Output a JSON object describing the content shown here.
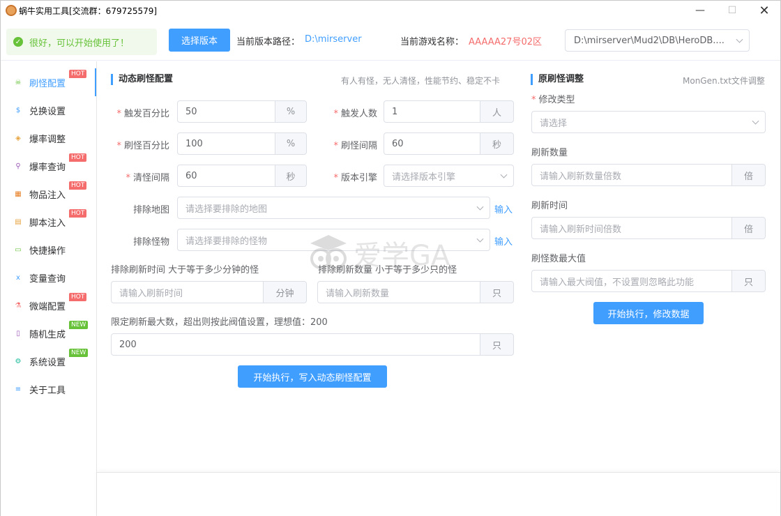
{
  "window": {
    "title": "蜗牛实用工具[交流群：679725579]",
    "controls": {
      "minimize": "—",
      "maximize": "☐",
      "close": "✕"
    }
  },
  "topbar": {
    "alert_text": "很好，可以开始使用了！",
    "select_version_label": "选择版本",
    "version_path_label": "当前版本路径：",
    "version_path_value": "D:\\mirserver",
    "game_name_label": "当前游戏名称：",
    "game_name_value": "AAAAA27号02区",
    "db_select_value": "D:\\mirserver\\Mud2\\DB\\HeroDB...."
  },
  "sidebar": {
    "items": [
      {
        "label": "刷怪配置",
        "icon": "monster-icon",
        "badge": "HOT",
        "active": true
      },
      {
        "label": "兑换设置",
        "icon": "exchange-icon",
        "badge": ""
      },
      {
        "label": "爆率调整",
        "icon": "cube-icon",
        "badge": ""
      },
      {
        "label": "爆率查询",
        "icon": "search-icon",
        "badge": "HOT"
      },
      {
        "label": "物品注入",
        "icon": "items-icon",
        "badge": "HOT"
      },
      {
        "label": "脚本注入",
        "icon": "script-icon",
        "badge": "HOT"
      },
      {
        "label": "快捷操作",
        "icon": "folder-icon",
        "badge": ""
      },
      {
        "label": "变量查询",
        "icon": "variable-icon",
        "badge": ""
      },
      {
        "label": "微端配置",
        "icon": "flask-icon",
        "badge": "HOT"
      },
      {
        "label": "随机生成",
        "icon": "random-icon",
        "badge": "NEW"
      },
      {
        "label": "系统设置",
        "icon": "gear-icon",
        "badge": "NEW"
      },
      {
        "label": "关于工具",
        "icon": "info-icon",
        "badge": ""
      }
    ]
  },
  "dynamic": {
    "title": "动态刷怪配置",
    "desc": "有人有怪，无人清怪，性能节约、稳定不卡",
    "trigger_percent": {
      "label": "触发百分比",
      "value": "50",
      "unit": "%"
    },
    "trigger_people": {
      "label": "触发人数",
      "value": "1",
      "unit": "人"
    },
    "spawn_percent": {
      "label": "刷怪百分比",
      "value": "100",
      "unit": "%"
    },
    "spawn_interval": {
      "label": "刷怪间隔",
      "value": "60",
      "unit": "秒"
    },
    "clear_interval": {
      "label": "清怪间隔",
      "value": "60",
      "unit": "秒"
    },
    "engine": {
      "label": "版本引擎",
      "placeholder": "请选择版本引擎"
    },
    "exclude_map": {
      "label": "排除地图",
      "placeholder": "请选择要排除的地图",
      "link": "输入"
    },
    "exclude_monster": {
      "label": "排除怪物",
      "placeholder": "请选择要排除的怪物",
      "link": "输入"
    },
    "exclude_time": {
      "label": "排除刷新时间 大于等于多少分钟的怪",
      "placeholder": "请输入刷新时间",
      "unit": "分钟"
    },
    "exclude_count": {
      "label": "排除刷新数量 小于等于多少只的怪",
      "placeholder": "请输入刷新数量",
      "unit": "只"
    },
    "max_limit": {
      "label": "限定刷新最大数，超出则按此阀值设置，理想值：200",
      "value": "200",
      "unit": "只"
    },
    "submit_label": "开始执行，写入动态刷怪配置"
  },
  "original": {
    "title": "原刷怪调整",
    "desc": "MonGen.txt文件调整",
    "modify_type": {
      "label": "修改类型",
      "placeholder": "请选择"
    },
    "refresh_count": {
      "label": "刷新数量",
      "placeholder": "请输入刷新数量倍数",
      "unit": "倍"
    },
    "refresh_time": {
      "label": "刷新时间",
      "placeholder": "请输入刷新时间倍数",
      "unit": "倍"
    },
    "max_monsters": {
      "label": "刷怪数最大值",
      "placeholder": "请输入最大阀值，不设置则忽略此功能",
      "unit": "只"
    },
    "submit_label": "开始执行，修改数据"
  },
  "watermark": {
    "text": "爱学GA"
  },
  "colors": {
    "primary": "#409eff",
    "success": "#67c23a",
    "danger": "#f56c6c",
    "border": "#dcdfe6"
  }
}
